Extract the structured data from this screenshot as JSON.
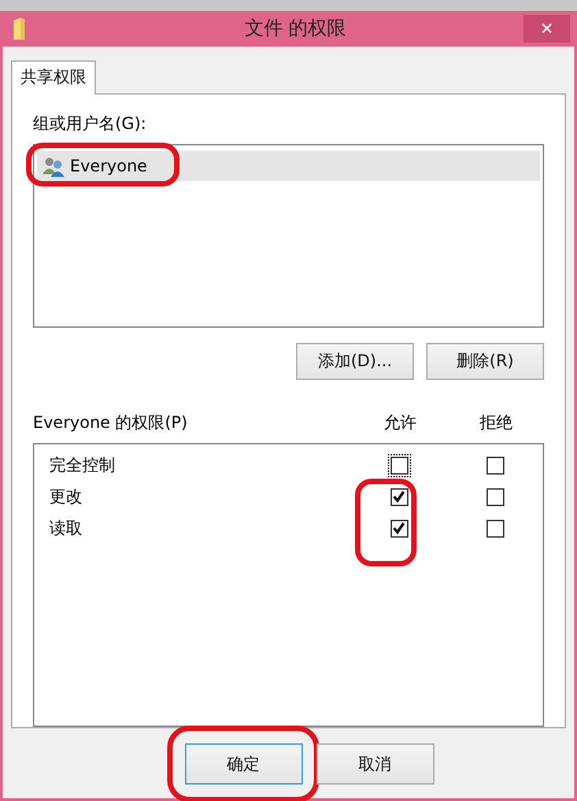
{
  "window": {
    "title": "文件 的权限",
    "close": "✕"
  },
  "tabs": [
    {
      "label": "共享权限",
      "selected": true
    }
  ],
  "group_label": "组或用户名(G):",
  "members": [
    {
      "name": "Everyone",
      "selected": true,
      "highlighted": true
    }
  ],
  "member_buttons": [
    "添加(D)...",
    "删除(R)"
  ],
  "permissions_label": "Everyone 的权限(P)",
  "columns": [
    "允许",
    "拒绝"
  ],
  "permissions": [
    {
      "name": "完全控制",
      "allow": false,
      "deny": false,
      "focused": true,
      "highlighted": false
    },
    {
      "name": "更改",
      "allow": true,
      "deny": false,
      "focused": false,
      "highlighted": true
    },
    {
      "name": "读取",
      "allow": true,
      "deny": false,
      "focused": false,
      "highlighted": true
    }
  ],
  "buttons": [
    {
      "label": "确定",
      "default": true,
      "highlighted": true
    },
    {
      "label": "取消",
      "default": false,
      "highlighted": false
    }
  ]
}
